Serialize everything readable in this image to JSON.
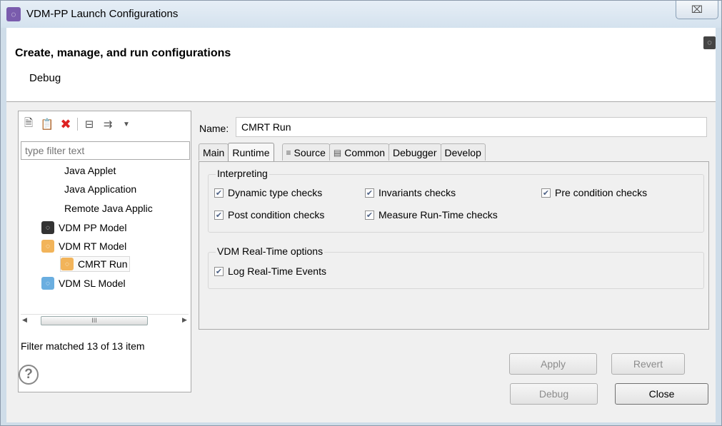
{
  "window": {
    "title": "VDM-PP Launch Configurations",
    "close_glyph": "⌧"
  },
  "header": {
    "title": "Create, manage, and run configurations",
    "subtitle": "Debug"
  },
  "left_panel": {
    "toolbar_icons": [
      "new-config-icon",
      "duplicate-icon",
      "delete-icon",
      "collapse-all-icon",
      "filter-icon",
      "dropdown-arrow-icon"
    ],
    "filter_placeholder": "type filter text",
    "tree": [
      {
        "label": "Java Applet",
        "type": "category"
      },
      {
        "label": "Java Application",
        "type": "category"
      },
      {
        "label": "Remote Java Applic",
        "type": "category"
      },
      {
        "label": "VDM PP Model",
        "type": "vdm-pp"
      },
      {
        "label": "VDM RT Model",
        "type": "vdm-rt"
      },
      {
        "label": "CMRT Run",
        "type": "vdm-rt-config",
        "selected": true
      },
      {
        "label": "VDM SL Model",
        "type": "vdm-sl"
      }
    ],
    "scroll_thumb": "III",
    "filter_status": "Filter matched 13 of 13 item"
  },
  "config": {
    "name_label": "Name:",
    "name_value": "CMRT Run",
    "tabs": [
      {
        "label": "Main",
        "icon": ""
      },
      {
        "label": "Runtime",
        "icon": "",
        "active": true
      },
      {
        "label": "Source",
        "icon": "source-icon"
      },
      {
        "label": "Common",
        "icon": "common-icon"
      },
      {
        "label": "Debugger",
        "icon": ""
      },
      {
        "label": "Develop",
        "icon": ""
      }
    ],
    "interpreting": {
      "legend": "Interpreting",
      "checks": [
        {
          "label": "Dynamic type checks",
          "checked": true
        },
        {
          "label": "Invariants checks",
          "checked": true
        },
        {
          "label": "Pre condition checks",
          "checked": true
        },
        {
          "label": "Post condition checks",
          "checked": true
        },
        {
          "label": "Measure Run-Time checks",
          "checked": true
        }
      ]
    },
    "realtime": {
      "legend": "VDM Real-Time options",
      "checks": [
        {
          "label": "Log Real-Time Events",
          "checked": true
        }
      ]
    },
    "apply_label": "Apply",
    "revert_label": "Revert"
  },
  "footer": {
    "help_glyph": "?",
    "debug_label": "Debug",
    "close_label": "Close"
  },
  "colors": {
    "title_bg": "#d4e2ee",
    "dialog_bg": "#f0f0f0",
    "check_color": "#4d6185",
    "vdm_rt_icon": "#f2b45a",
    "vdm_sl_icon": "#6aaee0"
  }
}
